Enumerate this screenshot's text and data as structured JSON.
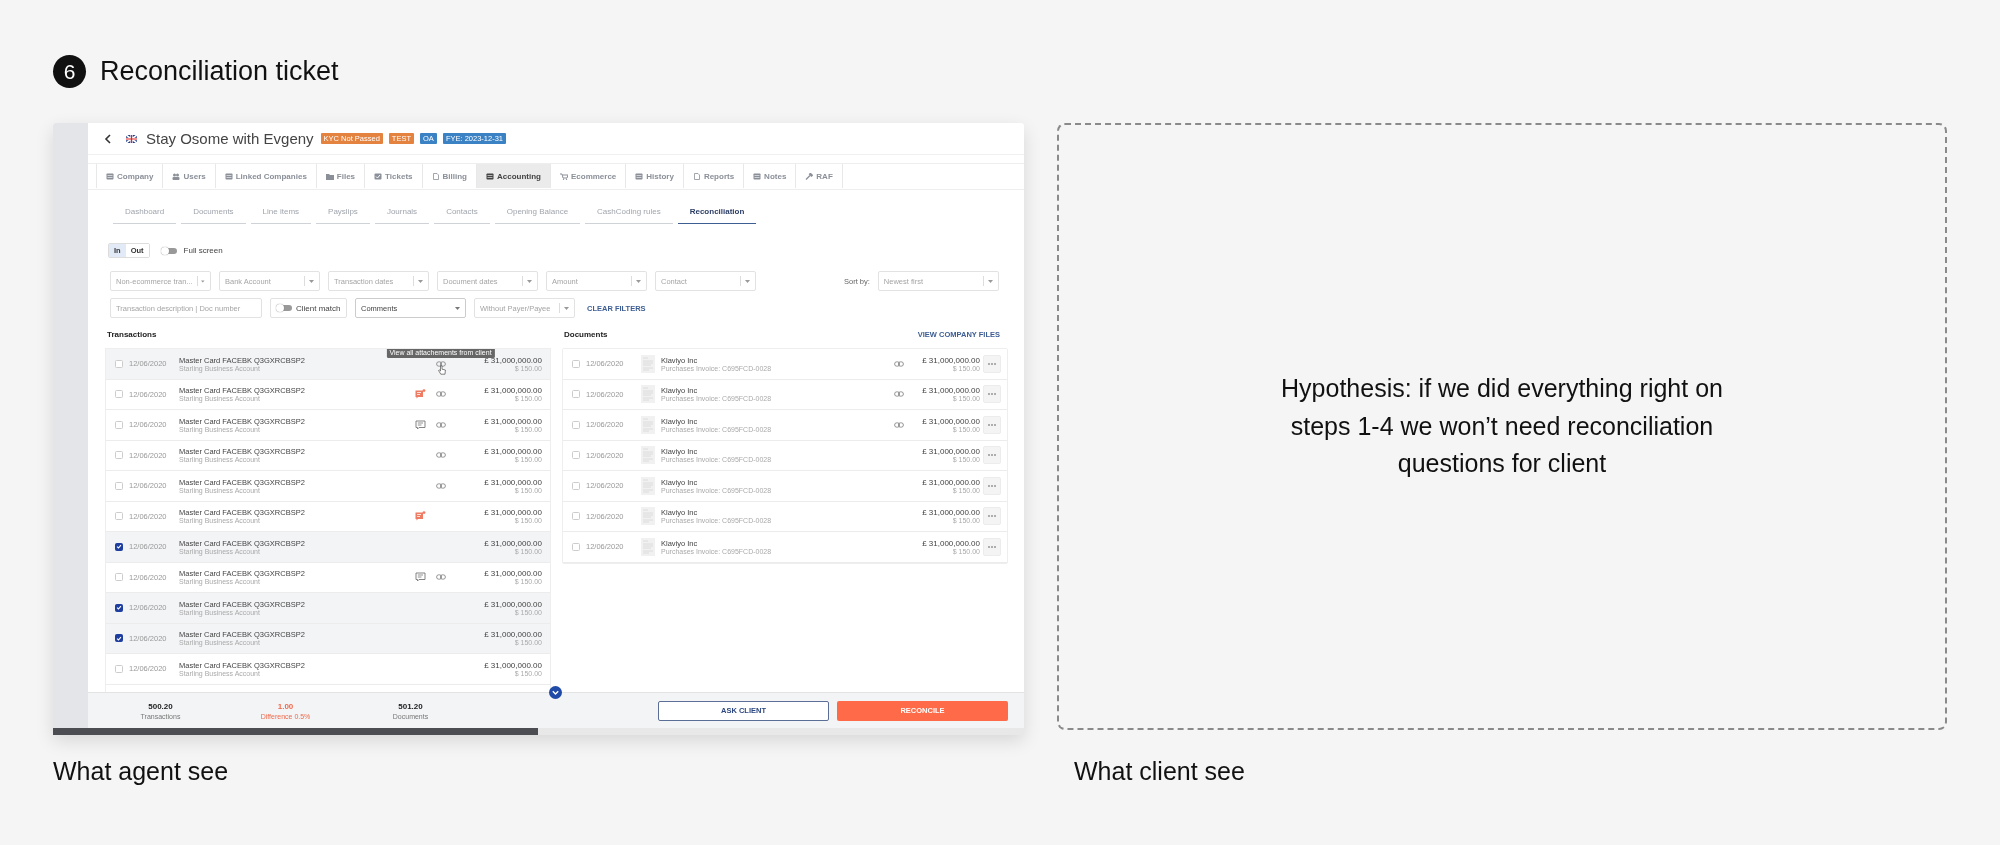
{
  "header": {
    "step": "6",
    "title": "Reconciliation ticket"
  },
  "agent_view": {
    "caption": "What agent see",
    "company": {
      "title": "Stay Osome with Evgeny",
      "tags": [
        {
          "label": "KYC Not Passed",
          "color": "#e4823f"
        },
        {
          "label": "TEST",
          "color": "#e4823f"
        },
        {
          "label": "OA",
          "color": "#3b82c4"
        },
        {
          "label": "FYE: 2023-12-31",
          "color": "#3b82c4"
        }
      ]
    },
    "tabs": [
      {
        "label": "Company",
        "selected": false
      },
      {
        "label": "Users",
        "selected": false
      },
      {
        "label": "Linked Companies",
        "selected": false
      },
      {
        "label": "Files",
        "selected": false
      },
      {
        "label": "Tickets",
        "selected": false
      },
      {
        "label": "Billing",
        "selected": false
      },
      {
        "label": "Accounting",
        "selected": true
      },
      {
        "label": "Ecommerce",
        "selected": false
      },
      {
        "label": "History",
        "selected": false
      },
      {
        "label": "Reports",
        "selected": false
      },
      {
        "label": "Notes",
        "selected": false
      },
      {
        "label": "RAF",
        "selected": false
      }
    ],
    "subtabs": [
      {
        "label": "Dashboard",
        "selected": false
      },
      {
        "label": "Documents",
        "selected": false
      },
      {
        "label": "Line items",
        "selected": false
      },
      {
        "label": "Payslips",
        "selected": false
      },
      {
        "label": "Journals",
        "selected": false
      },
      {
        "label": "Contacts",
        "selected": false
      },
      {
        "label": "Opening Balance",
        "selected": false
      },
      {
        "label": "CashCoding rules",
        "selected": false
      },
      {
        "label": "Reconciliation",
        "selected": true
      }
    ],
    "direction": [
      {
        "label": "In",
        "selected": true
      },
      {
        "label": "Out",
        "selected": false
      }
    ],
    "full_screen": {
      "label": "Full screen",
      "on": false
    },
    "filters": [
      {
        "placeholder": "Non-ecommerce tran..."
      },
      {
        "placeholder": "Bank Account"
      },
      {
        "placeholder": "Transaction dates"
      },
      {
        "placeholder": "Document dates"
      },
      {
        "placeholder": "Amount"
      },
      {
        "placeholder": "Contact"
      }
    ],
    "sort": {
      "label": "Sort by:",
      "value": "Newest first"
    },
    "search": {
      "placeholder": "Transaction description | Doc number"
    },
    "client_match": {
      "label": "Client match",
      "on": false
    },
    "comments_select": {
      "value": "Comments"
    },
    "payer_filter": {
      "placeholder": "Without Payer/Payee"
    },
    "clear_filters": "CLEAR FILTERS",
    "transactions": {
      "title": "Transactions",
      "rows": [
        {
          "checked": false,
          "date": "12/06/2020",
          "description": "Master Card FACEBK Q3GXRCBSP2",
          "account": "Starling Business Account",
          "amount": "£ 31,000,000.00",
          "amount_secondary": "$ 150.00",
          "commented": false,
          "attachment": true,
          "tooltip": "View all attachements from client"
        },
        {
          "checked": false,
          "date": "12/06/2020",
          "description": "Master Card FACEBK Q3GXRCBSP2",
          "account": "Starling Business Account",
          "amount": "£ 31,000,000.00",
          "amount_secondary": "$ 150.00",
          "commented": true,
          "unread": true,
          "attachment": true
        },
        {
          "checked": false,
          "date": "12/06/2020",
          "description": "Master Card FACEBK Q3GXRCBSP2",
          "account": "Starling Business Account",
          "amount": "£ 31,000,000.00",
          "amount_secondary": "$ 150.00",
          "commented": true,
          "unread": false,
          "attachment": true
        },
        {
          "checked": false,
          "date": "12/06/2020",
          "description": "Master Card FACEBK Q3GXRCBSP2",
          "account": "Starling Business Account",
          "amount": "£ 31,000,000.00",
          "amount_secondary": "$ 150.00",
          "commented": false,
          "attachment": true
        },
        {
          "checked": false,
          "date": "12/06/2020",
          "description": "Master Card FACEBK Q3GXRCBSP2",
          "account": "Starling Business Account",
          "amount": "£ 31,000,000.00",
          "amount_secondary": "$ 150.00",
          "commented": false,
          "attachment": true
        },
        {
          "checked": false,
          "date": "12/06/2020",
          "description": "Master Card FACEBK Q3GXRCBSP2",
          "account": "Starling Business Account",
          "amount": "£ 31,000,000.00",
          "amount_secondary": "$ 150.00",
          "commented": true,
          "unread": true,
          "attachment": false
        },
        {
          "checked": true,
          "date": "12/06/2020",
          "description": "Master Card FACEBK Q3GXRCBSP2",
          "account": "Starling Business Account",
          "amount": "£ 31,000,000.00",
          "amount_secondary": "$ 150.00",
          "commented": false,
          "attachment": false
        },
        {
          "checked": false,
          "date": "12/06/2020",
          "description": "Master Card FACEBK Q3GXRCBSP2",
          "account": "Starling Business Account",
          "amount": "£ 31,000,000.00",
          "amount_secondary": "$ 150.00",
          "commented": true,
          "unread": false,
          "attachment": true
        },
        {
          "checked": true,
          "date": "12/06/2020",
          "description": "Master Card FACEBK Q3GXRCBSP2",
          "account": "Starling Business Account",
          "amount": "£ 31,000,000.00",
          "amount_secondary": "$ 150.00",
          "commented": false,
          "attachment": false
        },
        {
          "checked": true,
          "date": "12/06/2020",
          "description": "Master Card FACEBK Q3GXRCBSP2",
          "account": "Starling Business Account",
          "amount": "£ 31,000,000.00",
          "amount_secondary": "$ 150.00",
          "commented": false,
          "attachment": false
        },
        {
          "checked": false,
          "date": "12/06/2020",
          "description": "Master Card FACEBK Q3GXRCBSP2",
          "account": "Starling Business Account",
          "amount": "£ 31,000,000.00",
          "amount_secondary": "$ 150.00",
          "commented": false,
          "attachment": false
        }
      ]
    },
    "documents": {
      "title": "Documents",
      "link": "VIEW COMPANY FILES",
      "rows": [
        {
          "checked": false,
          "date": "12/06/2020",
          "vendor": "Klaviyo Inc",
          "reference": "Purchases Invoice: C695FCD-0028",
          "amount": "£ 31,000,000.00",
          "amount_secondary": "$ 150.00",
          "attachment": true
        },
        {
          "checked": false,
          "date": "12/06/2020",
          "vendor": "Klaviyo Inc",
          "reference": "Purchases Invoice: C695FCD-0028",
          "amount": "£ 31,000,000.00",
          "amount_secondary": "$ 150.00",
          "attachment": true
        },
        {
          "checked": false,
          "date": "12/06/2020",
          "vendor": "Klaviyo Inc",
          "reference": "Purchases Invoice: C695FCD-0028",
          "amount": "£ 31,000,000.00",
          "amount_secondary": "$ 150.00",
          "attachment": true
        },
        {
          "checked": false,
          "date": "12/06/2020",
          "vendor": "Klaviyo Inc",
          "reference": "Purchases Invoice: C695FCD-0028",
          "amount": "£ 31,000,000.00",
          "amount_secondary": "$ 150.00",
          "attachment": false
        },
        {
          "checked": false,
          "date": "12/06/2020",
          "vendor": "Klaviyo Inc",
          "reference": "Purchases Invoice: C695FCD-0028",
          "amount": "£ 31,000,000.00",
          "amount_secondary": "$ 150.00",
          "attachment": false
        },
        {
          "checked": false,
          "date": "12/06/2020",
          "vendor": "Klaviyo Inc",
          "reference": "Purchases Invoice: C695FCD-0028",
          "amount": "£ 31,000,000.00",
          "amount_secondary": "$ 150.00",
          "attachment": false
        },
        {
          "checked": false,
          "date": "12/06/2020",
          "vendor": "Klaviyo Inc",
          "reference": "Purchases Invoice: C695FCD-0028",
          "amount": "£ 31,000,000.00",
          "amount_secondary": "$ 150.00",
          "attachment": false
        }
      ]
    },
    "summary": [
      {
        "value": "500.20",
        "label": "Transactions",
        "kind": "normal"
      },
      {
        "value": "1.00",
        "label": "Difference 0.5%",
        "kind": "alert"
      },
      {
        "value": "501.20",
        "label": "Documents",
        "kind": "normal"
      }
    ],
    "buttons": [
      {
        "label": "ASK CLIENT",
        "kind": "secondary"
      },
      {
        "label": "RECONCILE",
        "kind": "primary"
      }
    ]
  },
  "client_view": {
    "caption": "What client see",
    "hypothesis": "Hypothesis: if we did everything right on steps 1-4 we won’t need reconciliation questions for client"
  }
}
